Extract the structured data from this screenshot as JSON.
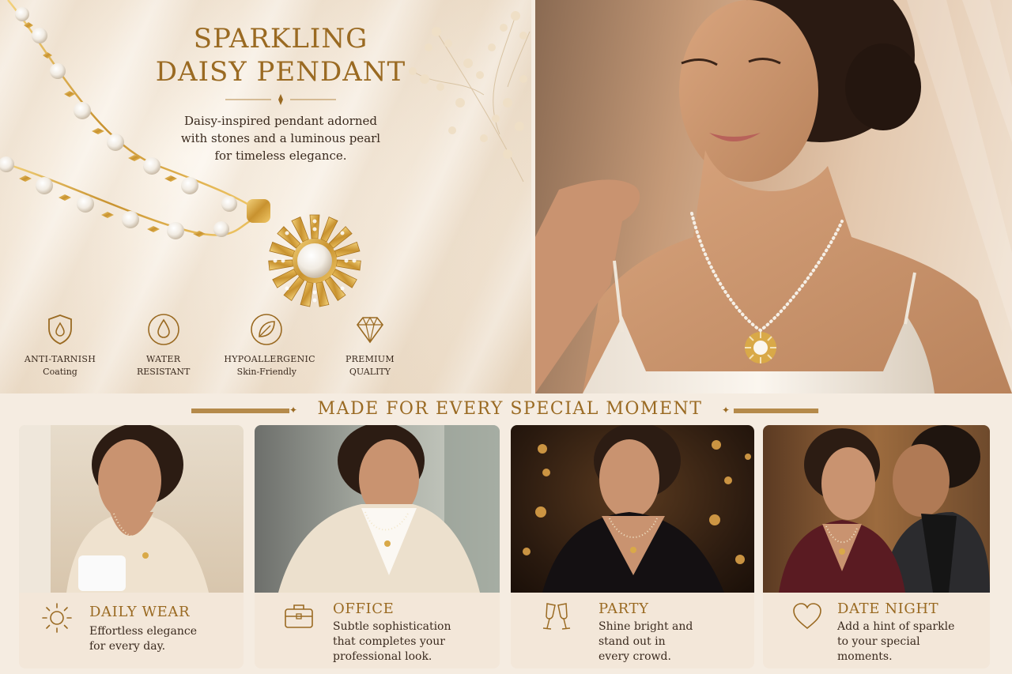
{
  "hero": {
    "title_line1": "SPARKLING",
    "title_line2": "DAISY PENDANT",
    "subtitle_line1": "Daisy-inspired pendant adorned",
    "subtitle_line2": "with stones and a luminous pearl",
    "subtitle_line3": "for timeless elegance."
  },
  "features": [
    {
      "icon": "shield-drop-icon",
      "line1": "ANTI-TARNISH",
      "line2": "Coating"
    },
    {
      "icon": "water-drop-icon",
      "line1": "WATER",
      "line2": "RESISTANT"
    },
    {
      "icon": "leaf-icon",
      "line1": "HYPOALLERGENIC",
      "line2": "Skin-Friendly"
    },
    {
      "icon": "diamond-icon",
      "line1": "PREMIUM",
      "line2": "QUALITY"
    }
  ],
  "section": {
    "title": "MADE FOR EVERY SPECIAL MOMENT"
  },
  "cards": [
    {
      "icon": "sun-icon",
      "title": "DAILY WEAR",
      "desc_line1": "Effortless elegance",
      "desc_line2": "for every day.",
      "desc_line3": ""
    },
    {
      "icon": "briefcase-icon",
      "title": "OFFICE",
      "desc_line1": "Subtle sophistication",
      "desc_line2": "that completes your",
      "desc_line3": "professional look."
    },
    {
      "icon": "champagne-icon",
      "title": "PARTY",
      "desc_line1": "Shine bright and",
      "desc_line2": "stand out in",
      "desc_line3": "every crowd."
    },
    {
      "icon": "heart-icon",
      "title": "DATE NIGHT",
      "desc_line1": "Add a hint of sparkle",
      "desc_line2": "to your special",
      "desc_line3": "moments."
    }
  ],
  "colors": {
    "gold": "#9a6a22",
    "cream": "#f5ece1",
    "text": "#3a2a1e"
  }
}
